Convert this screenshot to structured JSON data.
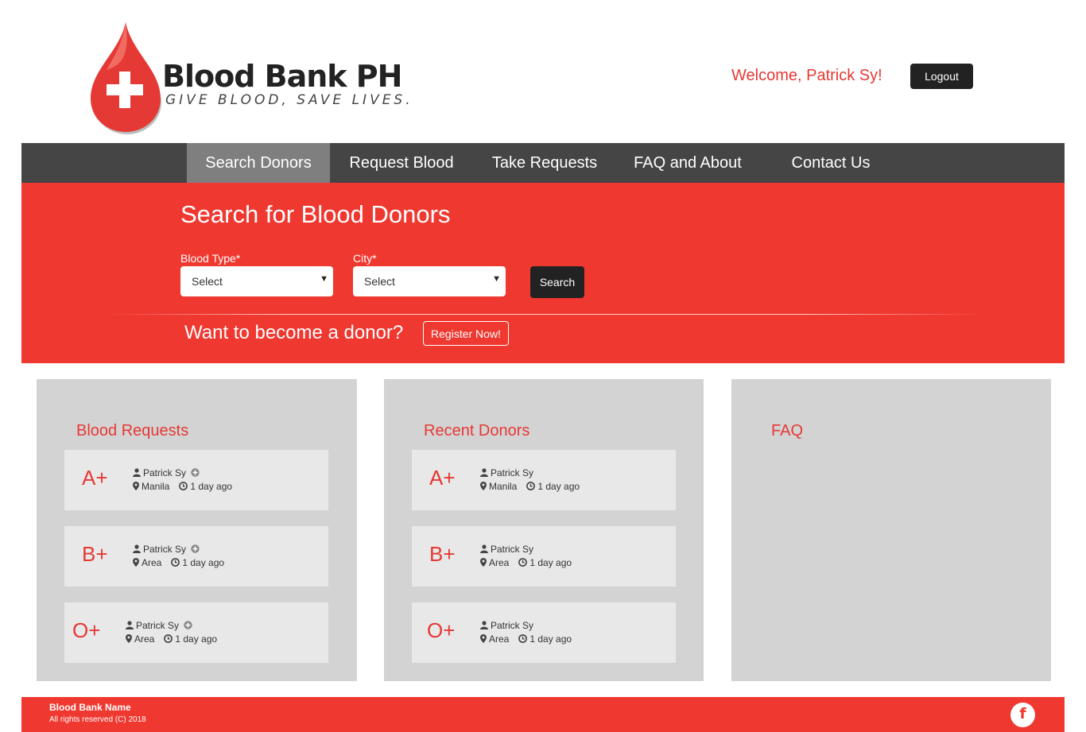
{
  "header": {
    "brand_name": "Blood Bank PH",
    "tagline": "GIVE BLOOD, SAVE LIVES.",
    "welcome": "Welcome, Patrick Sy!",
    "logout_label": "Logout"
  },
  "nav": {
    "items": [
      {
        "label": "Search Donors",
        "active": true
      },
      {
        "label": "Request Blood",
        "active": false
      },
      {
        "label": "Take Requests",
        "active": false
      },
      {
        "label": "FAQ and About",
        "active": false
      },
      {
        "label": "Contact Us",
        "active": false
      }
    ]
  },
  "search": {
    "title": "Search for Blood Donors",
    "blood_type_label": "Blood Type*",
    "blood_type_value": "Select",
    "city_label": "City*",
    "city_value": "Select",
    "search_label": "Search",
    "cta_text": "Want to become a donor?",
    "register_label": "Register Now!"
  },
  "requests": {
    "title": "Blood Requests",
    "items": [
      {
        "blood_type": "A+",
        "name": "Patrick Sy",
        "location": "Manila",
        "time": "1 day ago"
      },
      {
        "blood_type": "B+",
        "name": "Patrick Sy",
        "location": "Area",
        "time": "1 day ago"
      },
      {
        "blood_type": "O+",
        "name": "Patrick Sy",
        "location": "Area",
        "time": "1 day ago"
      }
    ]
  },
  "donors": {
    "title": "Recent Donors",
    "items": [
      {
        "blood_type": "A+",
        "name": "Patrick Sy",
        "location": "Manila",
        "time": "1 day ago"
      },
      {
        "blood_type": "B+",
        "name": "Patrick Sy",
        "location": "Area",
        "time": "1 day ago"
      },
      {
        "blood_type": "O+",
        "name": "Patrick Sy",
        "location": "Area",
        "time": "1 day ago"
      }
    ]
  },
  "faq": {
    "title": "FAQ"
  },
  "footer": {
    "name": "Blood Bank Name",
    "rights": "All rights reserved (C) 2018",
    "social_icon": "facebook-icon"
  },
  "colors": {
    "brand_red": "#ef3830",
    "text_red": "#e53935",
    "nav_bg": "#454545",
    "nav_active": "#7f7f7f",
    "panel_bg": "#d3d3d3",
    "entry_bg": "#e8e8e8",
    "dark_button": "#222222"
  }
}
